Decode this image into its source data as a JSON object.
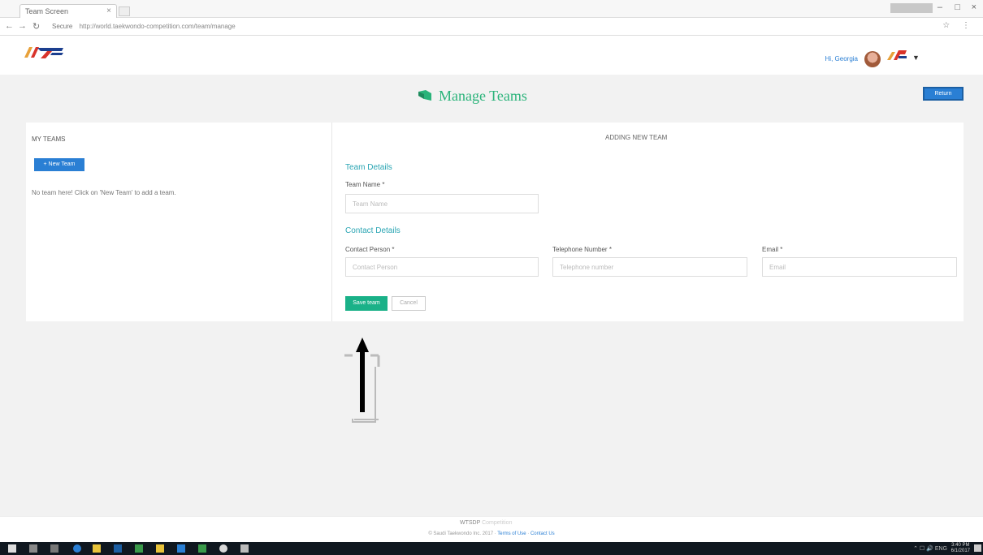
{
  "browser": {
    "tab_title": "Team Screen",
    "tab_close": "×",
    "url": "http://world.taekwondo-competition.com/team/manage",
    "secure_label": "Secure",
    "nav": {
      "back": "←",
      "forward": "→",
      "reload": "↻"
    },
    "window_controls": {
      "minimize": "–",
      "maximize": "□",
      "close": "×"
    },
    "addr_icons": "☆ ⋮"
  },
  "header": {
    "user_name": "Hi, Georgia",
    "caret": "▼"
  },
  "page": {
    "title": "Manage Teams",
    "return_button": "Return"
  },
  "my_teams": {
    "title": "MY TEAMS",
    "new_team_button": "+ New Team",
    "empty_message": "No team here! Click on 'New Team' to add a team."
  },
  "form": {
    "title": "ADDING NEW TEAM",
    "team_details_title": "Team Details",
    "team_name_label": "Team Name *",
    "team_name_placeholder": "Team Name",
    "contact_details_title": "Contact Details",
    "contact_person_label": "Contact Person *",
    "contact_person_placeholder": "Contact Person",
    "telephone_label": "Telephone Number *",
    "telephone_placeholder": "Telephone number",
    "email_label": "Email *",
    "email_placeholder": "Email",
    "save_button": "Save team",
    "cancel_button": "Cancel"
  },
  "footer": {
    "brand": "WTSDP",
    "brand_suffix": "Competition",
    "copyright": "© Saudi Taekwondo Inc. 2017 · ",
    "terms_link": "Terms of Use",
    "separator": " · ",
    "contact_link": "Contact Us"
  },
  "taskbar": {
    "tray": "⌃ ☐ 🔊 ENG",
    "time": "3:40 PM",
    "date": "6/1/2017"
  },
  "colors": {
    "accent_green": "#1ab188",
    "title_green": "#2ab37a",
    "brand_blue": "#2a7fd4",
    "section_teal": "#2aa5b3"
  }
}
